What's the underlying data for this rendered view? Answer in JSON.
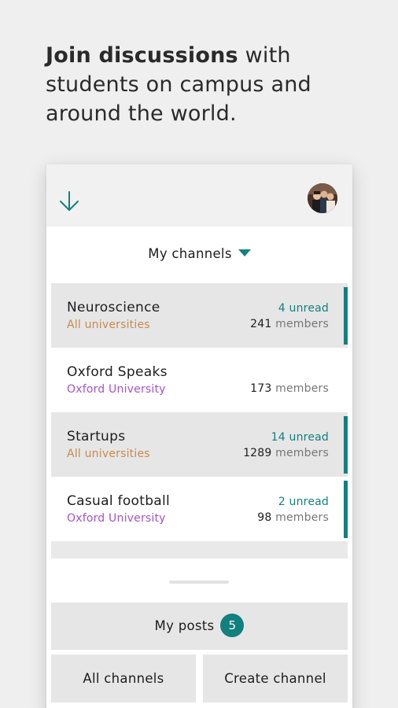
{
  "headline": {
    "bold": "Join discussions",
    "rest": " with students on campus and around the world."
  },
  "appbar": {
    "down_icon": "arrow-down-icon",
    "avatar": "profile-avatar"
  },
  "channels_toggle": {
    "label": "My channels",
    "icon": "caret-down-icon"
  },
  "channels": [
    {
      "name": "Neuroscience",
      "org": "All universities",
      "unread": "4 unread",
      "member_count": "241",
      "member_word": " members"
    },
    {
      "name": "Oxford Speaks",
      "org": "Oxford University",
      "unread": "",
      "member_count": "173",
      "member_word": " members"
    },
    {
      "name": "Startups",
      "org": "All universities",
      "unread": "14 unread",
      "member_count": "1289",
      "member_word": " members"
    },
    {
      "name": "Casual football",
      "org": "Oxford University",
      "unread": "2 unread",
      "member_count": "98",
      "member_word": " members"
    }
  ],
  "posts_button": {
    "label": "My posts",
    "count": "5"
  },
  "all_channels_button": {
    "label": "All channels"
  },
  "create_channel_button": {
    "label": "Create channel"
  },
  "colors": {
    "accent": "#12807f",
    "all_universities": "#c98a4a",
    "university": "#a652c8"
  }
}
